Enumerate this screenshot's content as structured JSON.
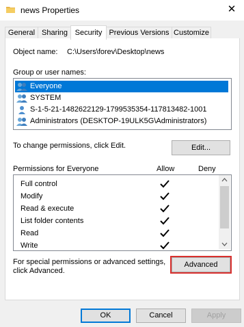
{
  "window": {
    "title": "news Properties",
    "close_glyph": "✕"
  },
  "tabs": [
    {
      "label": "General"
    },
    {
      "label": "Sharing"
    },
    {
      "label": "Security"
    },
    {
      "label": "Previous Versions"
    },
    {
      "label": "Customize"
    }
  ],
  "active_tab": "Security",
  "object": {
    "label": "Object name:",
    "value": "C:\\Users\\forev\\Desktop\\news"
  },
  "groups": {
    "label": "Group or user names:",
    "items": [
      {
        "name": "Everyone",
        "icon": "users-group-icon",
        "selected": true
      },
      {
        "name": "SYSTEM",
        "icon": "users-group-icon",
        "selected": false
      },
      {
        "name": "S-1-5-21-1482622129-1799535354-117813482-1001",
        "icon": "user-icon",
        "selected": false
      },
      {
        "name": "Administrators (DESKTOP-19ULK5G\\Administrators)",
        "icon": "users-group-icon",
        "selected": false
      }
    ]
  },
  "edit": {
    "hint": "To change permissions, click Edit.",
    "button": "Edit..."
  },
  "permissions": {
    "label": "Permissions for Everyone",
    "allow_header": "Allow",
    "deny_header": "Deny",
    "rows": [
      {
        "name": "Full control",
        "allow": true,
        "deny": false
      },
      {
        "name": "Modify",
        "allow": true,
        "deny": false
      },
      {
        "name": "Read & execute",
        "allow": true,
        "deny": false
      },
      {
        "name": "List folder contents",
        "allow": true,
        "deny": false
      },
      {
        "name": "Read",
        "allow": true,
        "deny": false
      },
      {
        "name": "Write",
        "allow": true,
        "deny": false
      }
    ]
  },
  "advanced": {
    "hint_line1": "For special permissions or advanced settings,",
    "hint_line2": "click Advanced.",
    "button": "Advanced"
  },
  "footer": {
    "ok": "OK",
    "cancel": "Cancel",
    "apply": "Apply"
  },
  "colors": {
    "selection": "#0078d7",
    "highlight_outline": "#d9302e"
  }
}
